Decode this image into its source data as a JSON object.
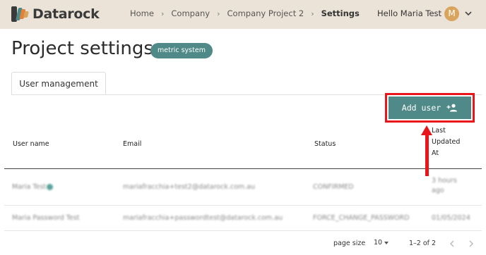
{
  "app": {
    "name": "Datarock"
  },
  "breadcrumb": [
    "Home",
    "Company",
    "Company Project 2",
    "Settings"
  ],
  "user": {
    "greeting": "Hello Maria Test",
    "initial": "M"
  },
  "page": {
    "title": "Project settings",
    "badge": "metric system"
  },
  "tabs": [
    {
      "label": "User management",
      "active": true
    }
  ],
  "actions": {
    "add_user_label": "Add user",
    "add_user_icon": "person-add-icon"
  },
  "table": {
    "columns": [
      "User name",
      "Email",
      "Status",
      "Last Updated At"
    ],
    "last_updated_lines": [
      "Last",
      "Updated",
      "At"
    ],
    "rows": [
      {
        "name": "Maria Test",
        "email": "mariafracchia+test2@datarock.com.au",
        "status": "CONFIRMED",
        "updated_lines": [
          "3 hours",
          "ago"
        ]
      },
      {
        "name": "Maria Password Test",
        "email": "mariafracchia+passwordtest@datarock.com.au",
        "status": "FORCE_CHANGE_PASSWORD",
        "updated": "01/05/2024"
      }
    ]
  },
  "pagination": {
    "page_size_label": "page size",
    "page_size": "10",
    "range": "1–2 of 2"
  },
  "colors": {
    "header_bg": "#ebe3d8",
    "accent": "#4f8a88",
    "highlight": "#e8161b",
    "avatar": "#d9a55e"
  }
}
